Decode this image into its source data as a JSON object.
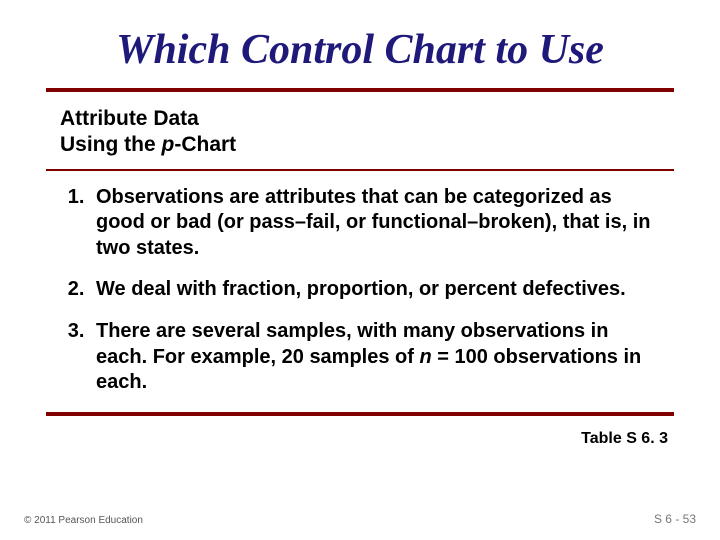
{
  "title": "Which Control Chart to Use",
  "subhead": {
    "line1": "Attribute Data",
    "line2_prefix": "Using the ",
    "line2_ital": "p",
    "line2_suffix": "-Chart"
  },
  "points": {
    "item1": "Observations are attributes that can be categorized as good or bad (or pass–fail, or functional–broken), that is, in two states.",
    "item2": "We deal with fraction, proportion, or percent defectives.",
    "item3_a": "There are several samples, with many observations in each. For example, 20 samples of ",
    "item3_ital": "n",
    "item3_b": " = 100 observations in each."
  },
  "table_ref": "Table S 6. 3",
  "footer": {
    "left": "© 2011 Pearson Education",
    "right": "S 6 - 53"
  }
}
